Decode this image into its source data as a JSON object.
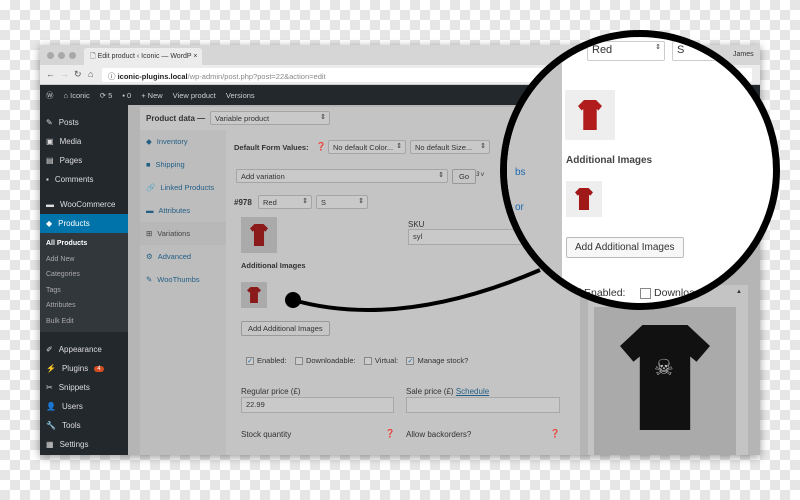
{
  "browser": {
    "tab_title": "Edit product ‹ Iconic — WordP",
    "url_host": "iconic-plugins.local",
    "url_path": "/wp-admin/post.php?post=22&action=edit",
    "user": "James"
  },
  "adminbar": {
    "site": "Iconic",
    "updates": "5",
    "comments": "0",
    "new": "New",
    "view": "View product",
    "versions": "Versions"
  },
  "sidebar": {
    "items": [
      "Posts",
      "Media",
      "Pages",
      "Comments",
      "WooCommerce",
      "Products"
    ],
    "sub": [
      "All Products",
      "Add New",
      "Categories",
      "Tags",
      "Attributes",
      "Bulk Edit"
    ],
    "items2": [
      "Appearance",
      "Plugins",
      "Snippets",
      "Users",
      "Tools",
      "Settings"
    ],
    "plugins_badge": "4"
  },
  "product": {
    "label": "Product data —",
    "type": "Variable product",
    "tabs": [
      "Inventory",
      "Shipping",
      "Linked Products",
      "Attributes",
      "Variations",
      "Advanced",
      "WooThumbs"
    ],
    "default_label": "Default Form Values:",
    "default_color": "No default Color...",
    "default_size": "No default Size...",
    "add_variation": "Add variation",
    "go": "Go",
    "variation_count": "3 v",
    "var_id": "#978",
    "var_color": "Red",
    "var_size": "S",
    "sku_label": "SKU",
    "sku": "syl",
    "additional_images": "Additional Images",
    "add_images_button": "Add Additional Images",
    "enabled": "Enabled:",
    "downloadable": "Downloadable:",
    "virtual": "Virtual:",
    "manage_stock": "Manage stock?",
    "regular_price_label": "Regular price (£)",
    "regular_price": "22.99",
    "sale_price_label": "Sale price (£)",
    "schedule": "Schedule",
    "stock_qty": "Stock quantity",
    "backorders": "Allow backorders?"
  },
  "magnifier": {
    "var_id_fragment": "78",
    "color": "Red",
    "size": "S",
    "additional_images": "Additional Images",
    "add_button": "Add Additional Images",
    "enabled": "Enabled:",
    "downloadable_fragment": "Downloa",
    "link1": "bs",
    "link2": "or"
  },
  "colors": {
    "admin_dark": "#23282d",
    "accent": "#0073aa",
    "shirt_red": "#b11d1d"
  }
}
